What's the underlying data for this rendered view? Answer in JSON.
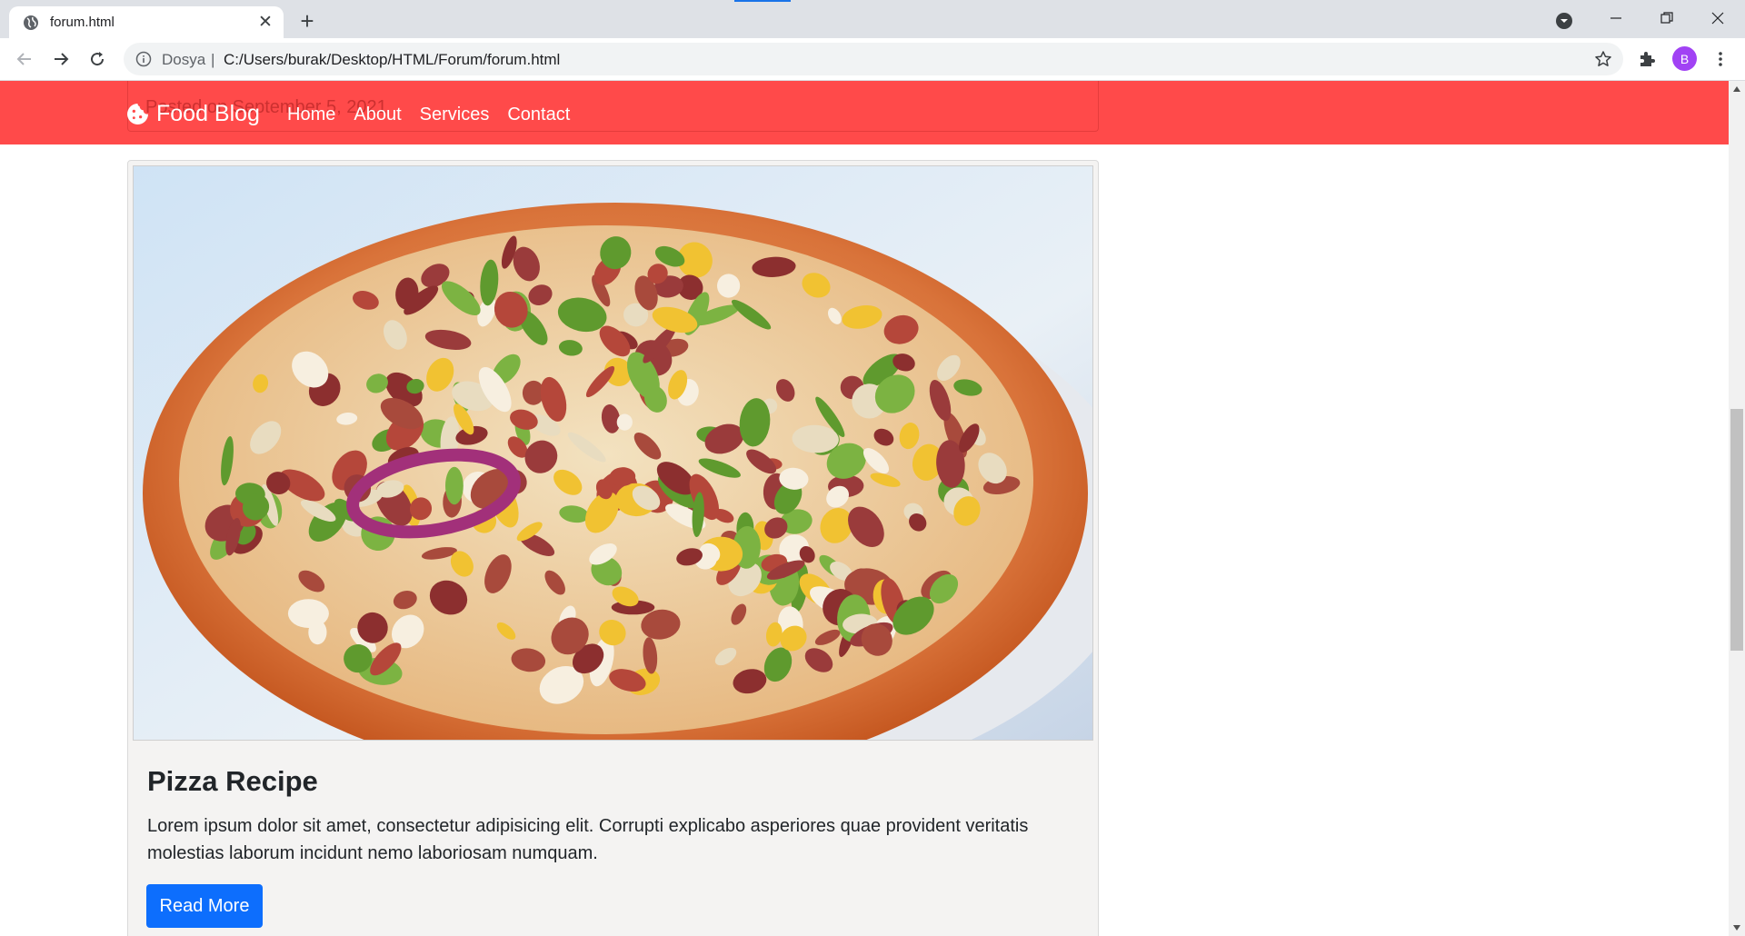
{
  "browser": {
    "tab_title": "forum.html",
    "close_glyph": "✕",
    "new_tab_glyph": "+",
    "nav_icons": [
      "back-arrow-icon",
      "forward-arrow-icon",
      "reload-icon"
    ],
    "omnibox": {
      "origin_label": "Dosya",
      "separator": "|",
      "url": "C:/Users/burak/Desktop/HTML/Forum/forum.html"
    },
    "profile_initial": "B",
    "profile_color": "#a142f4",
    "accent_color": "#1a73e8"
  },
  "page": {
    "navbar": {
      "background_color": "#ff4a4a",
      "brand": "Food Blog",
      "brand_icon": "cookie-icon",
      "links": [
        "Home",
        "About",
        "Services",
        "Contact"
      ]
    },
    "previous_card_meta": "Posted on September 5, 2021",
    "card": {
      "image_subject": "pizza",
      "title": "Pizza Recipe",
      "text": "Lorem ipsum dolor sit amet, consectetur adipisicing elit. Corrupti explicabo asperiores quae provident veritatis molestias laborum incidunt nemo laboriosam numquam.",
      "button_label": "Read More",
      "button_color": "#0d6efd"
    }
  }
}
